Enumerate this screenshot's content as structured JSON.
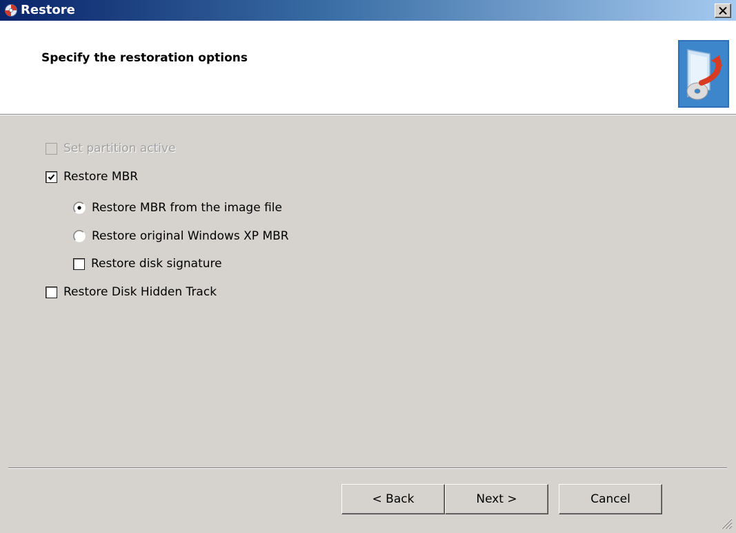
{
  "window": {
    "title": "Restore",
    "close_symbol": "✕"
  },
  "header": {
    "title": "Specify the restoration options",
    "icon": "restore-disc-icon"
  },
  "options": {
    "set_partition_active": {
      "label": "Set partition active",
      "checked": false,
      "enabled": false
    },
    "restore_mbr": {
      "label": "Restore MBR",
      "checked": true,
      "enabled": true
    },
    "mbr_from_image": {
      "label": "Restore MBR from the image file",
      "selected": true
    },
    "original_xp_mbr": {
      "label": "Restore original Windows XP MBR",
      "selected": false
    },
    "restore_disk_signature": {
      "label": "Restore disk signature",
      "checked": false
    },
    "restore_hidden_track": {
      "label": "Restore Disk Hidden Track",
      "checked": false
    }
  },
  "buttons": {
    "back": "< Back",
    "next": "Next >",
    "cancel": "Cancel"
  }
}
